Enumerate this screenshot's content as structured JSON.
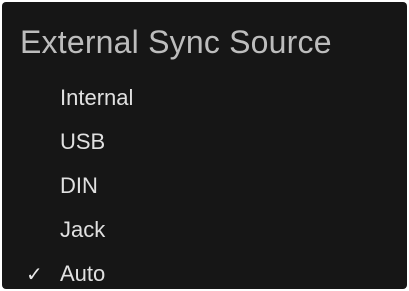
{
  "title": "External Sync Source",
  "menu": {
    "items": [
      {
        "label": "Internal",
        "checked": false
      },
      {
        "label": "USB",
        "checked": false
      },
      {
        "label": "DIN",
        "checked": false
      },
      {
        "label": "Jack",
        "checked": false
      },
      {
        "label": "Auto",
        "checked": true
      }
    ],
    "check_glyph": "✓",
    "check_icon": "checkmark-icon"
  },
  "colors": {
    "background": "#161616",
    "title": "#bdbdbd",
    "text": "#e0e0e0"
  }
}
